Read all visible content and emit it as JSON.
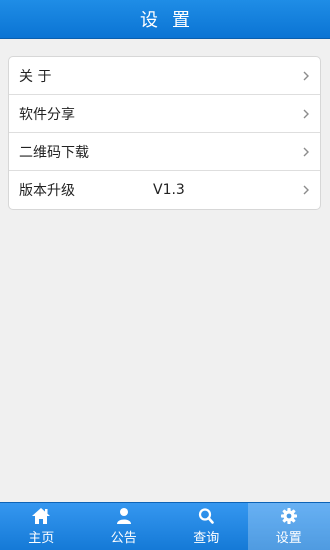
{
  "header": {
    "title": "设置"
  },
  "menu": {
    "items": [
      {
        "label": "关 于",
        "value": ""
      },
      {
        "label": "软件分享",
        "value": ""
      },
      {
        "label": "二维码下载",
        "value": ""
      },
      {
        "label": "版本升级",
        "value": "V1.3"
      }
    ]
  },
  "tabbar": {
    "tabs": [
      {
        "label": "主页",
        "icon": "home-icon"
      },
      {
        "label": "公告",
        "icon": "person-icon"
      },
      {
        "label": "查询",
        "icon": "search-icon"
      },
      {
        "label": "设置",
        "icon": "gear-icon",
        "active": true
      }
    ]
  },
  "colors": {
    "header_bg": "#0b74d4",
    "tabbar_bg": "#1a80dd",
    "page_bg": "#f0f0f0"
  }
}
